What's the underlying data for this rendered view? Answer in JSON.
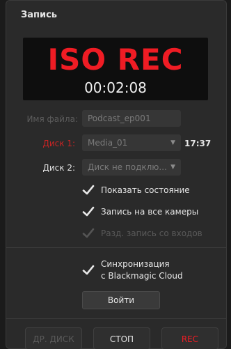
{
  "panel": {
    "title": "Запись"
  },
  "display": {
    "status": "ISO REC",
    "timecode": "00:02:08",
    "status_color": "#ef1c24"
  },
  "filename": {
    "label": "Имя файла:",
    "value": "Podcast_ep001"
  },
  "disk1": {
    "label": "Диск 1:",
    "value": "Media_01",
    "time": "17:37",
    "label_color": "#c82424"
  },
  "disk2": {
    "label": "Диск 2:",
    "value": "Диск не подклю..."
  },
  "options": {
    "show_status": {
      "label": "Показать состояние",
      "checked": true
    },
    "record_all": {
      "label": "Запись на все камеры",
      "checked": true
    },
    "separate": {
      "label": "Разд. запись со входов",
      "checked": true,
      "disabled": true
    }
  },
  "sync": {
    "label_line1": "Синхронизация",
    "label_line2": "с Blackmagic Cloud",
    "checked": true,
    "login_button": "Войти"
  },
  "buttons": {
    "alt_disk": "ДР. ДИСК",
    "stop": "СТОП",
    "rec": "REC",
    "rec_color": "#ef1c24"
  },
  "icons": {
    "check": "checkmark-icon",
    "dropdown": "chevron-down-icon"
  }
}
